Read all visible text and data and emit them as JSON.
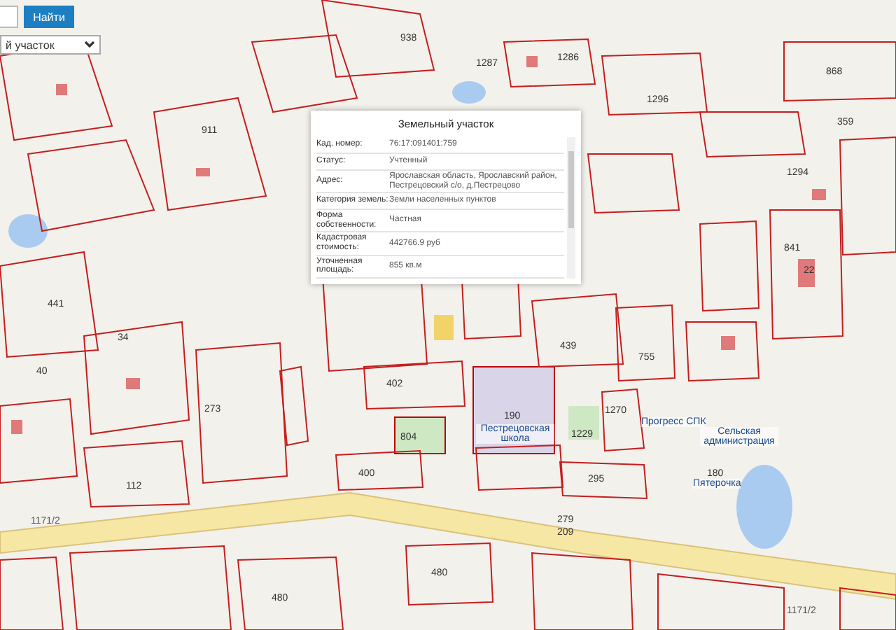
{
  "search": {
    "button": "Найти",
    "layer": "й участок"
  },
  "map_labels": [
    {
      "kind": "num",
      "text": "938"
    },
    {
      "kind": "num",
      "text": "1287"
    },
    {
      "kind": "num",
      "text": "1286"
    },
    {
      "kind": "num",
      "text": "1296"
    },
    {
      "kind": "num",
      "text": "868"
    },
    {
      "kind": "num",
      "text": "359"
    },
    {
      "kind": "num",
      "text": "911"
    },
    {
      "kind": "num",
      "text": "1294"
    },
    {
      "kind": "num",
      "text": "841"
    },
    {
      "kind": "num",
      "text": "22"
    },
    {
      "kind": "num",
      "text": "441"
    },
    {
      "kind": "num",
      "text": "34"
    },
    {
      "kind": "num",
      "text": "40"
    },
    {
      "kind": "num",
      "text": "439"
    },
    {
      "kind": "num",
      "text": "755"
    },
    {
      "kind": "num",
      "text": "273"
    },
    {
      "kind": "num",
      "text": "402"
    },
    {
      "kind": "num",
      "text": "804"
    },
    {
      "kind": "num",
      "text": "400"
    },
    {
      "kind": "num",
      "text": "190"
    },
    {
      "kind": "name",
      "text": "Пестрецовская школа"
    },
    {
      "kind": "num",
      "text": "1229"
    },
    {
      "kind": "num",
      "text": "1270"
    },
    {
      "kind": "name",
      "text": "Прогресс СПК"
    },
    {
      "kind": "name",
      "text": "Сельская администрация"
    },
    {
      "kind": "num",
      "text": "180"
    },
    {
      "kind": "name",
      "text": "Пятерочка"
    },
    {
      "kind": "num",
      "text": "295"
    },
    {
      "kind": "num",
      "text": "279"
    },
    {
      "kind": "num",
      "text": "209"
    },
    {
      "kind": "num",
      "text": "112"
    },
    {
      "kind": "road",
      "text": "1171/2"
    },
    {
      "kind": "num",
      "text": "480"
    },
    {
      "kind": "num",
      "text": "480"
    },
    {
      "kind": "road",
      "text": "1171/2"
    }
  ],
  "popup": {
    "title": "Земельный участок",
    "rows": [
      {
        "label": "Кад. номер:",
        "value": "76:17:091401:759"
      },
      {
        "label": "Статус:",
        "value": "Учтенный"
      },
      {
        "label": "Адрес:",
        "value": "Ярославская область, Ярославский район, Пестрецовский с/о, д.Пестрецово"
      },
      {
        "label": "Категория земель:",
        "value": "Земли населенных пунктов"
      },
      {
        "label": "Форма собственности:",
        "value": "Частная"
      },
      {
        "label": "Кадастровая стоимость:",
        "value": "442766.9 руб"
      },
      {
        "label": "Уточненная площадь:",
        "value": "855 кв.м"
      }
    ]
  }
}
